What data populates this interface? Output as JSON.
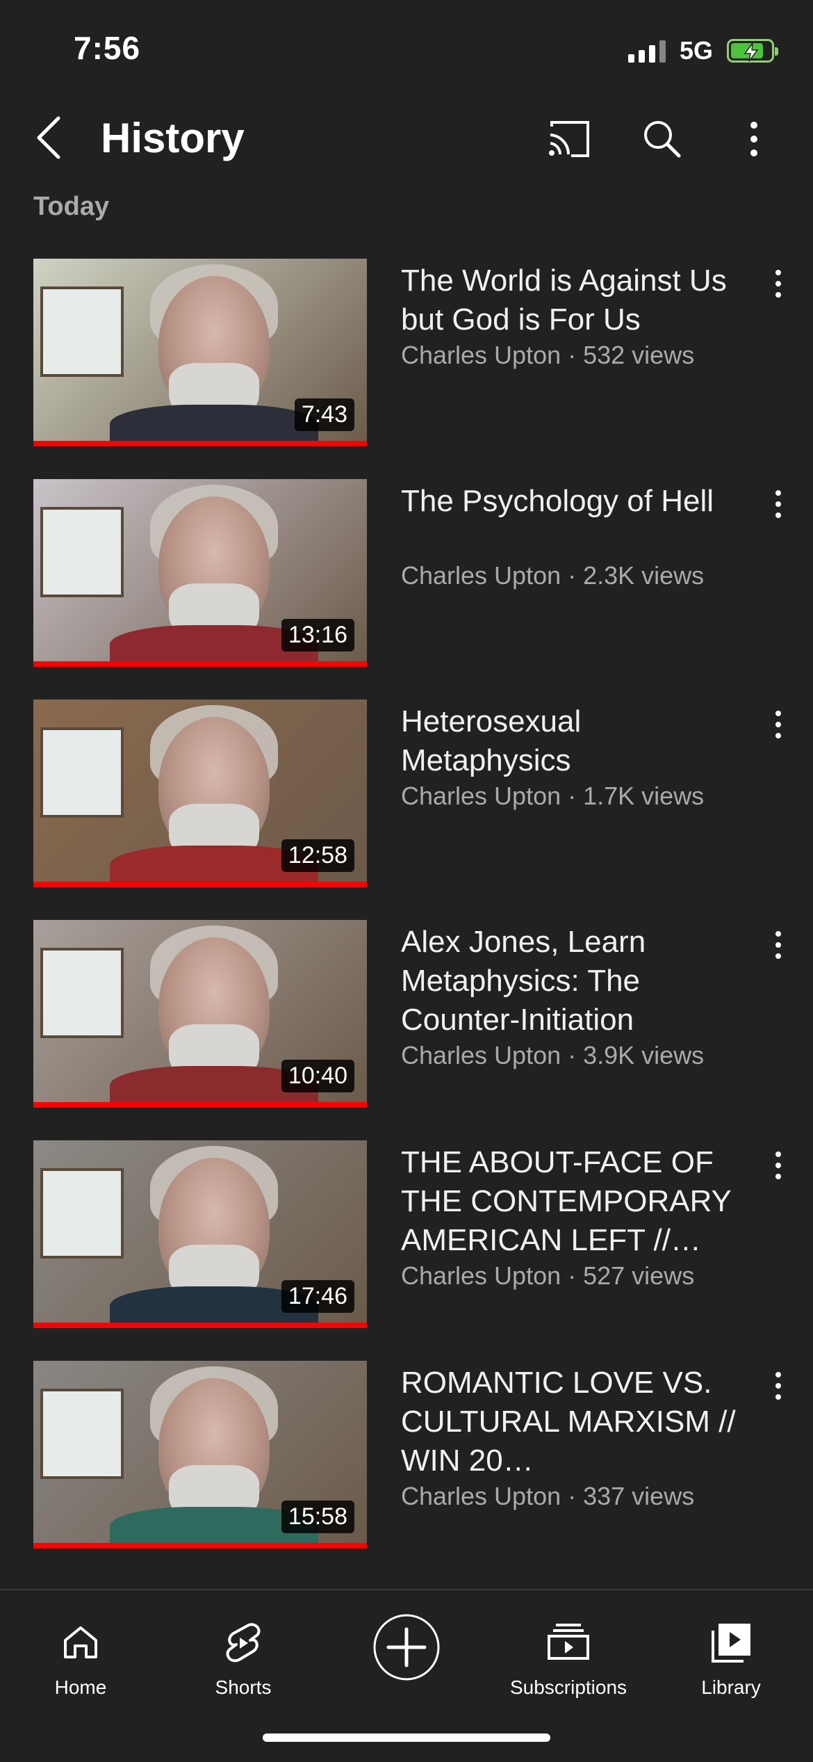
{
  "status_bar": {
    "time": "7:56",
    "network": "5G"
  },
  "header": {
    "title": "History"
  },
  "section": {
    "label": "Today"
  },
  "videos": [
    {
      "title": "The World is Against Us but God is For Us",
      "meta": "Charles Upton · 532 views",
      "duration": "7:43",
      "shirt": "#2c2f3a",
      "bg": "#cfd3c4"
    },
    {
      "title": "The Psychology of Hell",
      "meta": "Charles Upton · 2.3K views",
      "duration": "13:16",
      "shirt": "#8e2a2f",
      "bg": "#c9c3c9"
    },
    {
      "title": "Heterosexual Metaphysics",
      "meta": "Charles Upton · 1.7K views",
      "duration": "12:58",
      "shirt": "#9a2a2c",
      "bg": "#8a6a4e"
    },
    {
      "title": "Alex Jones, Learn Metaphysics: The Counter-Initiation",
      "meta": "Charles Upton · 3.9K views",
      "duration": "10:40",
      "shirt": "#8b2b2d",
      "bg": "#a8a09b"
    },
    {
      "title": "THE ABOUT-FACE OF THE CONTEMPORARY AMERICAN LEFT //…",
      "meta": "Charles Upton · 527 views",
      "duration": "17:46",
      "shirt": "#233240",
      "bg": "#8c8a86"
    },
    {
      "title": "ROMANTIC LOVE VS. CULTURAL MARXISM // WIN 20…",
      "meta": "Charles Upton · 337 views",
      "duration": "15:58",
      "shirt": "#2f6a5e",
      "bg": "#8a8784"
    }
  ],
  "nav": {
    "home": "Home",
    "shorts": "Shorts",
    "subscriptions": "Subscriptions",
    "library": "Library"
  },
  "colors": {
    "background": "#212121",
    "progress": "#ff0000",
    "secondary_text": "#aaaaaa"
  }
}
